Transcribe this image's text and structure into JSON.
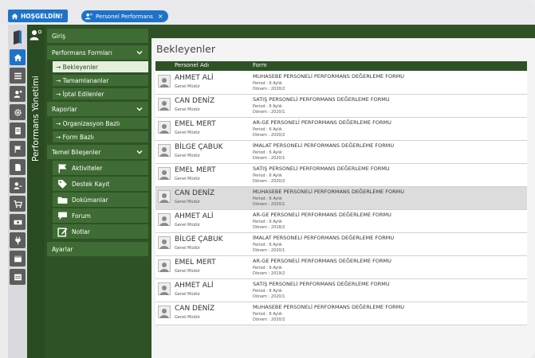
{
  "topbar": {
    "home_label": "HOŞGELDİN!",
    "tab_label": "Personel Performans",
    "tab_close": "×"
  },
  "sidebar_title": "Performans Yönetimi",
  "menu": {
    "giris": "Giriş",
    "performans_formlari": "Performans Formları",
    "bekleyenler": "→ Bekleyenler",
    "tamamlananlar": "→ Tamamlananlar",
    "iptal_edilenler": "→ İptal Edilenler",
    "raporlar": "Raporlar",
    "organizasyon_bazli": "→ Organizasyon Bazlı",
    "form_bazli": "→ Form Bazlı",
    "temel_bilesenler": "Temel Bileşenler",
    "aktiviteler": "Aktiviteler",
    "destek_kayit": "Destek Kayıt",
    "dokumanlar": "Dokümanlar",
    "forum": "Forum",
    "notlar": "Notlar",
    "ayarlar": "Ayarlar"
  },
  "main": {
    "title": "Bekleyenler",
    "col_personel": "Personel Adı",
    "col_form": "Form"
  },
  "rows": [
    {
      "name": "AHMET ALİ",
      "role": "Genel Müdür",
      "form": "MUHASEBE PERSONELİ PERFORMANS DEĞERLEME FORMU",
      "period": "Period : 6 Aylık",
      "donem": "Dönem : 2020/2"
    },
    {
      "name": "CAN DENİZ",
      "role": "Genel Müdür",
      "form": "SATIŞ PERSONELİ PERFORMANS DEĞERLEME FORMU",
      "period": "Period : 6 Aylık",
      "donem": "Dönem : 2020/1"
    },
    {
      "name": "EMEL MERT",
      "role": "Genel Müdür",
      "form": "AR-GE PERSONELİ PERFORMANS DEĞERLEME FORMU",
      "period": "Period : 6 Aylık",
      "donem": "Dönem : 2020/2"
    },
    {
      "name": "BİLGE ÇABUK",
      "role": "Genel Müdür",
      "form": "İMALAT PERSONELİ PERFORMANS DEĞERLEME FORMU",
      "period": "Period : 6 Aylık",
      "donem": "Dönem : 2020/1"
    },
    {
      "name": "EMEL MERT",
      "role": "Genel Müdür",
      "form": "SATIŞ PERSONELİ PERFORMANS DEĞERLEME FORMU",
      "period": "Period : 6 Aylık",
      "donem": "Dönem : 2020/2"
    },
    {
      "name": "CAN DENİZ",
      "role": "Genel Müdür",
      "form": "MUHASEBE PERSONELİ PERFORMANS DEĞERLEME FORMU",
      "period": "Period : 6 Aylık",
      "donem": "Dönem : 2020/1"
    },
    {
      "name": "AHMET ALİ",
      "role": "Genel Müdür",
      "form": "AR-GE PERSONELİ PERFORMANS DEĞERLEME FORMU",
      "period": "Period : 6 Aylık",
      "donem": "Dönem : 2018/2"
    },
    {
      "name": "BİLGE ÇABUK",
      "role": "Genel Müdür",
      "form": "İMALAT PERSONELİ PERFORMANS DEĞERLEME FORMU",
      "period": "Period : 6 Aylık",
      "donem": "Dönem : 2020/1"
    },
    {
      "name": "EMEL MERT",
      "role": "Genel Müdür",
      "form": "AR-GE PERSONELİ PERFORMANS DEĞERLEME FORMU",
      "period": "Period : 6 Aylık",
      "donem": "Dönem : 2019/2"
    },
    {
      "name": "AHMET ALİ",
      "role": "Genel Müdür",
      "form": "SATIŞ PERSONELİ PERFORMANS DEĞERLEME FORMU",
      "period": "Period : 6 Aylık",
      "donem": "Dönem : 2020/1"
    },
    {
      "name": "CAN DENİZ",
      "role": "Genel Müdür",
      "form": "MUHASEBE PERSONELİ PERFORMANS DEĞERLEME FORMU",
      "period": "Period : 6 Aylık",
      "donem": "Dönem : 2020/2"
    }
  ],
  "colors": {
    "accent_blue": "#1e73c8",
    "dark_green": "#2e5226",
    "menu_green": "#3f6c34",
    "active_submenu": "#e4f0dc"
  }
}
